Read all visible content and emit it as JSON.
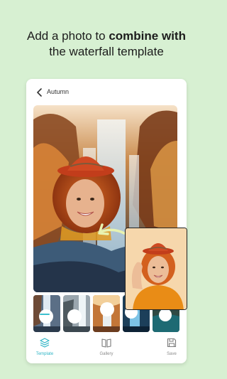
{
  "headline": {
    "pre": "Add a photo to ",
    "emphasis": "combine with",
    "post": "the waterfall template"
  },
  "screen": {
    "title": "Autumn"
  },
  "nav": {
    "template": "Template",
    "gallery": "Gallery",
    "save": "Save"
  },
  "colors": {
    "background": "#d7f0d2",
    "accent": "#2fb5c6",
    "arrow": "#e8f2b0"
  },
  "icons": {
    "back": "chevron-left-icon",
    "template": "layers-icon",
    "gallery": "book-icon",
    "save": "floppy-disk-icon"
  }
}
